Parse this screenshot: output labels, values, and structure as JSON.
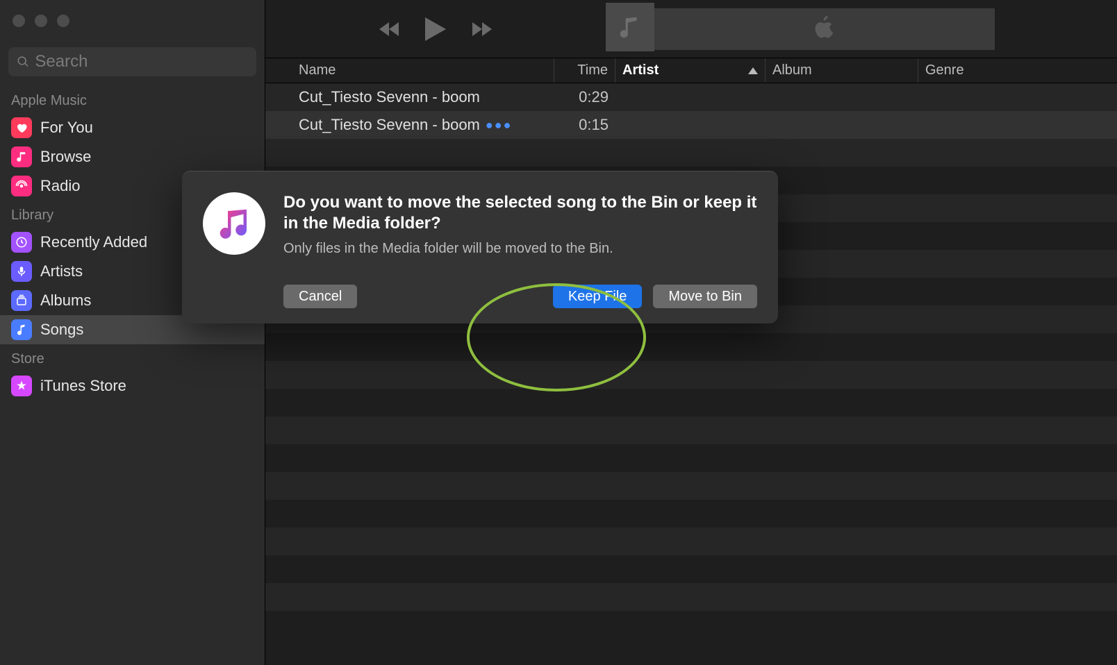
{
  "search": {
    "placeholder": "Search"
  },
  "sidebar": {
    "sections": [
      {
        "title": "Apple Music",
        "items": [
          {
            "label": "For You",
            "icon": "heart",
            "bg": "#ff3b5c"
          },
          {
            "label": "Browse",
            "icon": "music",
            "bg": "#ff2d80"
          },
          {
            "label": "Radio",
            "icon": "radio",
            "bg": "#ff2d80"
          }
        ]
      },
      {
        "title": "Library",
        "items": [
          {
            "label": "Recently Added",
            "icon": "clock",
            "bg": "#a352ff"
          },
          {
            "label": "Artists",
            "icon": "mic",
            "bg": "#6a5cff"
          },
          {
            "label": "Albums",
            "icon": "stack",
            "bg": "#5c6aff"
          },
          {
            "label": "Songs",
            "icon": "note",
            "bg": "#4a7cff",
            "selected": true
          }
        ]
      },
      {
        "title": "Store",
        "items": [
          {
            "label": "iTunes Store",
            "icon": "star",
            "bg": "#d648ff"
          }
        ]
      }
    ]
  },
  "columns": {
    "name": "Name",
    "time": "Time",
    "artist": "Artist",
    "album": "Album",
    "genre": "Genre"
  },
  "tracks": [
    {
      "name": "Cut_Tiesto Sevenn  - boom",
      "time": "0:29"
    },
    {
      "name": "Cut_Tiesto Sevenn  - boom",
      "time": "0:15",
      "selected": true,
      "more": true
    }
  ],
  "dialog": {
    "title": "Do you want to move the selected song to the Bin or keep it in the Media folder?",
    "subtitle": "Only files in the Media folder will be moved to the Bin.",
    "cancel": "Cancel",
    "keep": "Keep File",
    "move": "Move to Bin"
  }
}
